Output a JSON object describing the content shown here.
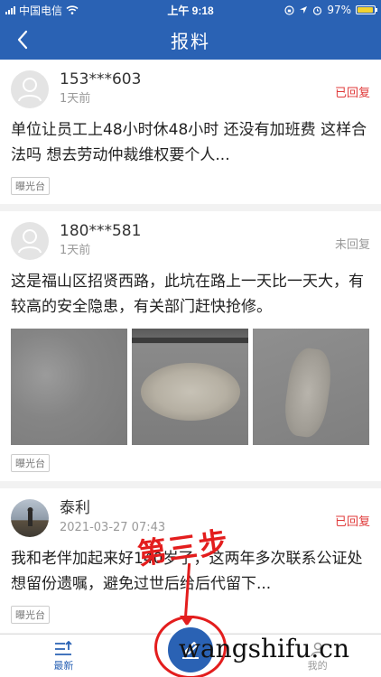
{
  "status_bar": {
    "carrier": "中国电信",
    "time": "上午 9:18",
    "battery": "97%",
    "battery_level": 0.97
  },
  "nav": {
    "title": "报料"
  },
  "posts": [
    {
      "user": "153***603",
      "time": "1天前",
      "status": "已回复",
      "text": "单位让员工上48小时休48小时  还没有加班费  这样合法吗  想去劳动仲裁维权要个人...",
      "tag": "曝光台"
    },
    {
      "user": "180***581",
      "time": "1天前",
      "status": "未回复",
      "text": "这是福山区招贤西路，此坑在路上一天比一天大，有较高的安全隐患，有关部门赶快抢修。",
      "tag": "曝光台"
    },
    {
      "user": "泰利",
      "time": "2021-03-27 07:43",
      "status": "已回复",
      "text": "我和老伴加起来好140岁了，这两年多次联系公证处想留份遗嘱，避免过世后给后代留下...",
      "tag": "曝光台"
    }
  ],
  "tabs": {
    "latest": "最新",
    "mine": "我的"
  },
  "annotation": "第三步",
  "watermark": "wangshifu.cn",
  "colors": {
    "brand": "#2a62b4",
    "replied": "#e03a3a",
    "annotation": "#e31d1d"
  }
}
